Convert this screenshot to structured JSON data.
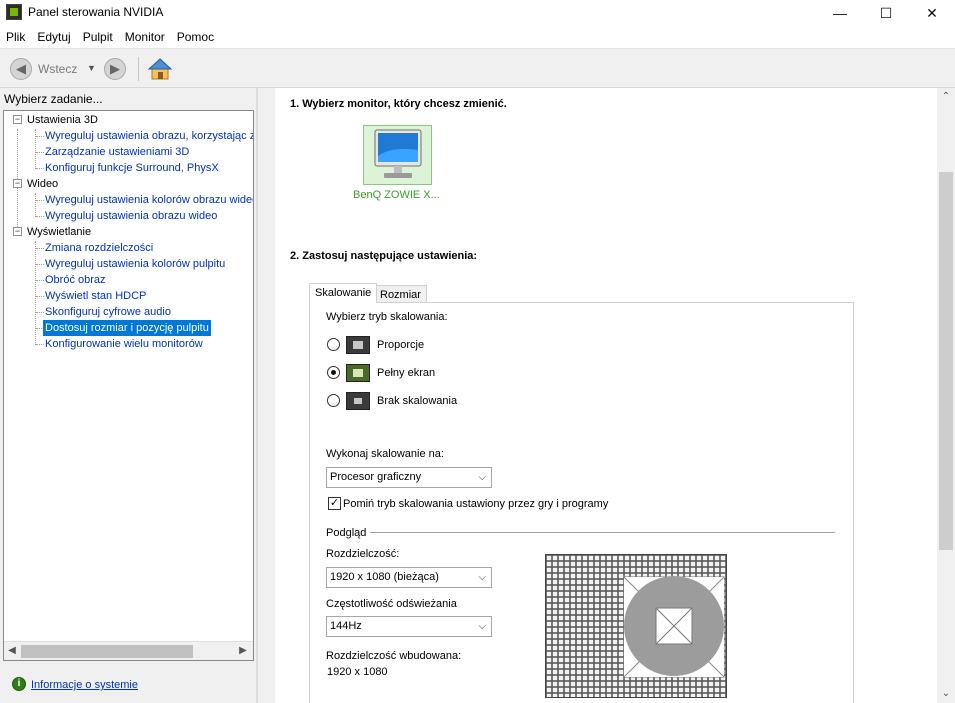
{
  "window": {
    "title": "Panel sterowania NVIDIA",
    "controls": {
      "minimize": "—",
      "maximize": "☐",
      "close": "✕"
    }
  },
  "menu": [
    "Plik",
    "Edytuj",
    "Pulpit",
    "Monitor",
    "Pomoc"
  ],
  "toolbar": {
    "back_label": "Wstecz",
    "back_dropdown": "▼",
    "back_glyph": "◀",
    "forward_glyph": "▶"
  },
  "left": {
    "header": "Wybierz zadanie...",
    "expander_glyph": "−",
    "tree": [
      {
        "label": "Ustawienia 3D",
        "leaves": [
          "Wyreguluj ustawienia obrazu, korzystając z",
          "Zarządzanie ustawieniami 3D",
          "Konfiguruj funkcje Surround, PhysX"
        ]
      },
      {
        "label": "Wideo",
        "leaves": [
          "Wyreguluj ustawienia kolorów obrazu wideo",
          "Wyreguluj ustawienia obrazu wideo"
        ]
      },
      {
        "label": "Wyświetlanie",
        "leaves": [
          "Zmiana rozdzielczości",
          "Wyreguluj ustawienia kolorów pulpitu",
          "Obróć obraz",
          "Wyświetl stan HDCP",
          "Skonfiguruj cyfrowe audio",
          "Dostosuj rozmiar i pozycję pulpitu",
          "Konfigurowanie wielu monitorów"
        ]
      }
    ],
    "selected_leaf": "Dostosuj rozmiar i pozycję pulpitu",
    "scroll_left": "◀",
    "scroll_right": "▶",
    "system_info_icon": "i",
    "system_info_link": "Informacje o systemie"
  },
  "right": {
    "step1_title": "1. Wybierz monitor, który chcesz zmienić.",
    "monitor_label": "BenQ ZOWIE X...",
    "step2_title": "2. Zastosuj następujące ustawienia:",
    "tabs": [
      "Skalowanie",
      "Rozmiar"
    ],
    "scaling_mode_label": "Wybierz tryb skalowania:",
    "scaling_modes": [
      {
        "label": "Proporcje",
        "selected": false
      },
      {
        "label": "Pełny ekran",
        "selected": true
      },
      {
        "label": "Brak skalowania",
        "selected": false
      }
    ],
    "perform_on_label": "Wykonaj skalowanie na:",
    "perform_on_value": "Procesor graficzny",
    "override_checkbox": {
      "label": "Pomiń tryb skalowania ustawiony przez gry i programy",
      "checked": true,
      "glyph": "✓"
    },
    "preview_label": "Podgląd",
    "resolution_label": "Rozdzielczość:",
    "resolution_value": "1920 x 1080 (bieżąca)",
    "refresh_label": "Częstotliwość odświeżania",
    "refresh_value": "144Hz",
    "native_label": "Rozdzielczość wbudowana:",
    "native_value": "1920 x 1080",
    "combo_chevron": "⌵",
    "scroll_up": "⌃",
    "scroll_down": "⌄"
  },
  "colors": {
    "accent": "#0078d7",
    "link": "#0033bb",
    "monitor_green": "#3b9a2a"
  }
}
